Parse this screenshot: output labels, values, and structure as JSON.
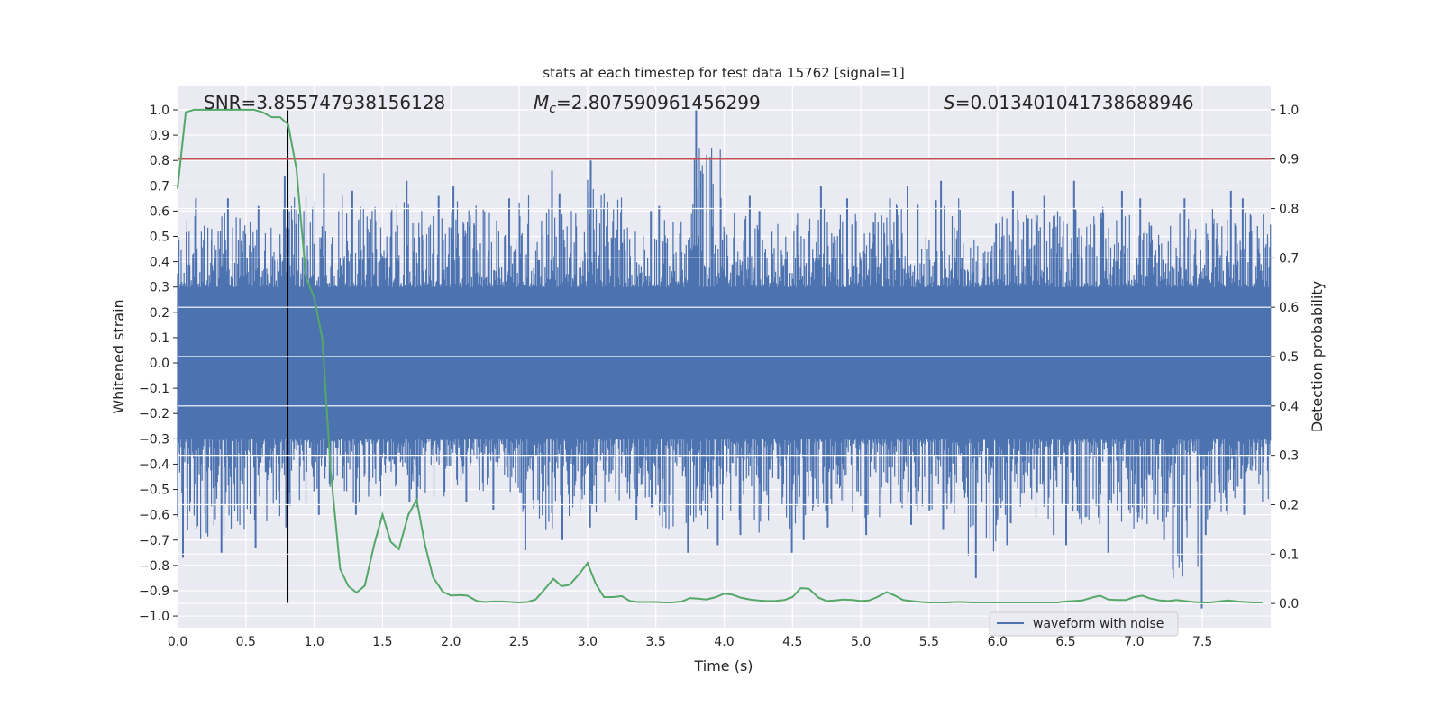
{
  "chart_data": {
    "type": "line",
    "title": "stats at each timestep for test data 15762 [signal=1]",
    "xlabel": "Time (s)",
    "ylabel": "Whitened strain",
    "y2label": "Detection probability",
    "xlim": [
      0,
      8
    ],
    "ylim": [
      -1.046,
      1.096
    ],
    "y2lim": [
      -0.049,
      1.049
    ],
    "grid": true,
    "legend_position": "lower-right",
    "xticks": [
      "0.0",
      "0.5",
      "1.0",
      "1.5",
      "2.0",
      "2.5",
      "3.0",
      "3.5",
      "4.0",
      "4.5",
      "5.0",
      "5.5",
      "6.0",
      "6.5",
      "7.0",
      "7.5"
    ],
    "yticks": [
      "1.0",
      "0.9",
      "0.8",
      "0.7",
      "0.6",
      "0.5",
      "0.4",
      "0.3",
      "0.2",
      "0.1",
      "0.0",
      "−0.1",
      "−0.2",
      "−0.3",
      "−0.4",
      "−0.5",
      "−0.6",
      "−0.7",
      "−0.8",
      "−0.9",
      "−1.0"
    ],
    "y2ticks": [
      "1.0",
      "0.9",
      "0.8",
      "0.7",
      "0.6",
      "0.5",
      "0.4",
      "0.3",
      "0.2",
      "0.1",
      "0.0"
    ],
    "annotations": {
      "snr": "SNR=3.855747938156128",
      "mc_symbol": "M",
      "mc_sub": "c",
      "mc_value": "=2.807590961456299",
      "s_symbol": "S",
      "s_value": "=0.013401041738688946"
    },
    "waveform": {
      "name": "waveform with noise",
      "color": "#4c72b0",
      "bin_width_s": 0.25,
      "bin_max": [
        0.65,
        0.65,
        0.62,
        0.74,
        0.75,
        0.68,
        0.72,
        0.66,
        0.7,
        0.65,
        0.76,
        0.67,
        0.8,
        0.6,
        0.62,
        1.0,
        0.66,
        0.6,
        0.7,
        0.65,
        0.65,
        0.7,
        0.72,
        0.55,
        0.68,
        0.66,
        0.72,
        0.68,
        0.65,
        0.65,
        0.68,
        0.65
      ],
      "bin_min": [
        -0.77,
        -0.75,
        -0.73,
        -0.65,
        -0.6,
        -0.6,
        -0.55,
        -0.57,
        -0.55,
        -0.58,
        -0.74,
        -0.7,
        -0.65,
        -0.62,
        -0.75,
        -0.72,
        -0.68,
        -0.75,
        -0.7,
        -0.65,
        -0.68,
        -0.64,
        -0.66,
        -0.85,
        -0.72,
        -0.68,
        -0.72,
        -0.75,
        -0.7,
        -0.97,
        -0.68,
        -0.6
      ]
    },
    "detection_probability": {
      "color": "#55a868",
      "t": [
        0.0,
        0.06,
        0.12,
        0.19,
        0.25,
        0.31,
        0.37,
        0.44,
        0.5,
        0.56,
        0.62,
        0.69,
        0.75,
        0.81,
        0.87,
        0.94,
        1.0,
        1.06,
        1.12,
        1.19,
        1.25,
        1.31,
        1.37,
        1.44,
        1.5,
        1.56,
        1.62,
        1.69,
        1.75,
        1.81,
        1.87,
        1.94,
        2.0,
        2.06,
        2.12,
        2.19,
        2.25,
        2.31,
        2.37,
        2.44,
        2.5,
        2.56,
        2.62,
        2.69,
        2.75,
        2.81,
        2.87,
        2.94,
        3.0,
        3.06,
        3.12,
        3.19,
        3.25,
        3.31,
        3.37,
        3.44,
        3.5,
        3.56,
        3.62,
        3.69,
        3.75,
        3.81,
        3.87,
        3.94,
        4.0,
        4.06,
        4.12,
        4.19,
        4.25,
        4.31,
        4.37,
        4.44,
        4.5,
        4.56,
        4.62,
        4.69,
        4.75,
        4.81,
        4.87,
        4.94,
        5.0,
        5.06,
        5.12,
        5.19,
        5.25,
        5.31,
        5.37,
        5.44,
        5.5,
        5.56,
        5.62,
        5.69,
        5.75,
        5.81,
        5.87,
        5.94,
        6.0,
        6.06,
        6.12,
        6.19,
        6.25,
        6.31,
        6.37,
        6.44,
        6.5,
        6.56,
        6.62,
        6.69,
        6.75,
        6.81,
        6.87,
        6.94,
        7.0,
        7.06,
        7.12,
        7.19,
        7.25,
        7.31,
        7.37,
        7.44,
        7.5,
        7.56,
        7.62,
        7.69,
        7.75,
        7.81,
        7.87,
        7.94
      ],
      "p": [
        0.84,
        0.995,
        1.0,
        1.0,
        1.0,
        1.0,
        1.0,
        1.0,
        1.0,
        1.0,
        0.995,
        0.985,
        0.985,
        0.97,
        0.88,
        0.66,
        0.62,
        0.535,
        0.27,
        0.07,
        0.035,
        0.022,
        0.036,
        0.12,
        0.18,
        0.125,
        0.11,
        0.18,
        0.21,
        0.12,
        0.053,
        0.024,
        0.016,
        0.017,
        0.016,
        0.005,
        0.003,
        0.004,
        0.004,
        0.003,
        0.002,
        0.003,
        0.008,
        0.03,
        0.05,
        0.035,
        0.038,
        0.06,
        0.082,
        0.04,
        0.013,
        0.013,
        0.015,
        0.005,
        0.003,
        0.003,
        0.003,
        0.002,
        0.002,
        0.004,
        0.011,
        0.01,
        0.008,
        0.013,
        0.02,
        0.018,
        0.012,
        0.008,
        0.006,
        0.005,
        0.005,
        0.007,
        0.013,
        0.031,
        0.03,
        0.012,
        0.005,
        0.006,
        0.008,
        0.007,
        0.005,
        0.006,
        0.013,
        0.023,
        0.016,
        0.007,
        0.005,
        0.003,
        0.002,
        0.002,
        0.002,
        0.003,
        0.003,
        0.002,
        0.002,
        0.002,
        0.002,
        0.002,
        0.002,
        0.002,
        0.002,
        0.002,
        0.002,
        0.002,
        0.004,
        0.005,
        0.006,
        0.012,
        0.016,
        0.008,
        0.007,
        0.007,
        0.013,
        0.016,
        0.01,
        0.006,
        0.005,
        0.007,
        0.005,
        0.003,
        0.002,
        0.002,
        0.004,
        0.006,
        0.004,
        0.003,
        0.002,
        0.002
      ]
    },
    "threshold": {
      "value": 0.9,
      "axis": "right",
      "color": "#c44e52"
    },
    "marker_time": {
      "value": 0.805,
      "color": "#000000"
    }
  }
}
